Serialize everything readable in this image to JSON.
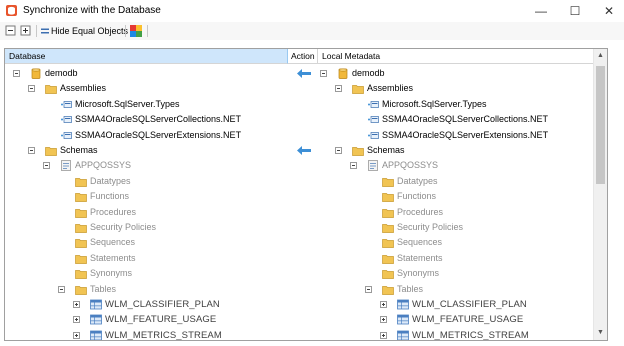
{
  "window": {
    "title": "Synchronize with the Database",
    "minimize": "—",
    "maximize": "☐",
    "close": "✕"
  },
  "toolbar": {
    "hide_equal_label": "Hide Equal Objects"
  },
  "columns": {
    "database": "Database",
    "action": "Action",
    "local": "Local Metadata"
  },
  "colors": {
    "header_selected": "#cfe6fb",
    "folder": "#f1c453",
    "arrow": "#3d8fd6",
    "table_icon": "#4a7fc1"
  },
  "tree": [
    {
      "label": "demodb",
      "icon": "database-icon",
      "expander": "minus",
      "action": "arrow-left",
      "tone": "normal"
    },
    {
      "label": "Assemblies",
      "icon": "folder-icon",
      "expander": "minus",
      "tone": "normal"
    },
    {
      "label": "Microsoft.SqlServer.Types",
      "icon": "assembly-icon",
      "expander": "none",
      "tone": "normal"
    },
    {
      "label": "SSMA4OracleSQLServerCollections.NET",
      "icon": "assembly-icon",
      "expander": "none",
      "tone": "normal"
    },
    {
      "label": "SSMA4OracleSQLServerExtensions.NET",
      "icon": "assembly-icon",
      "expander": "none",
      "tone": "normal"
    },
    {
      "label": "Schemas",
      "icon": "folder-icon",
      "expander": "minus",
      "action": "arrow-left",
      "tone": "normal"
    },
    {
      "label": "APPQOSSYS",
      "icon": "schema-icon",
      "expander": "minus",
      "tone": "grey"
    },
    {
      "label": "Datatypes",
      "icon": "folder-icon",
      "expander": "none",
      "tone": "grey"
    },
    {
      "label": "Functions",
      "icon": "folder-icon",
      "expander": "none",
      "tone": "grey"
    },
    {
      "label": "Procedures",
      "icon": "folder-icon",
      "expander": "none",
      "tone": "grey"
    },
    {
      "label": "Security Policies",
      "icon": "folder-icon",
      "expander": "none",
      "tone": "grey"
    },
    {
      "label": "Sequences",
      "icon": "folder-icon",
      "expander": "none",
      "tone": "grey"
    },
    {
      "label": "Statements",
      "icon": "folder-icon",
      "expander": "none",
      "tone": "grey"
    },
    {
      "label": "Synonyms",
      "icon": "folder-icon",
      "expander": "none",
      "tone": "grey"
    },
    {
      "label": "Tables",
      "icon": "folder-icon",
      "expander": "minus",
      "tone": "grey"
    },
    {
      "label": "WLM_CLASSIFIER_PLAN",
      "icon": "table-icon",
      "expander": "plus",
      "tone": "dark"
    },
    {
      "label": "WLM_FEATURE_USAGE",
      "icon": "table-icon",
      "expander": "plus",
      "tone": "dark"
    },
    {
      "label": "WLM_METRICS_STREAM",
      "icon": "table-icon",
      "expander": "plus",
      "tone": "dark"
    }
  ]
}
